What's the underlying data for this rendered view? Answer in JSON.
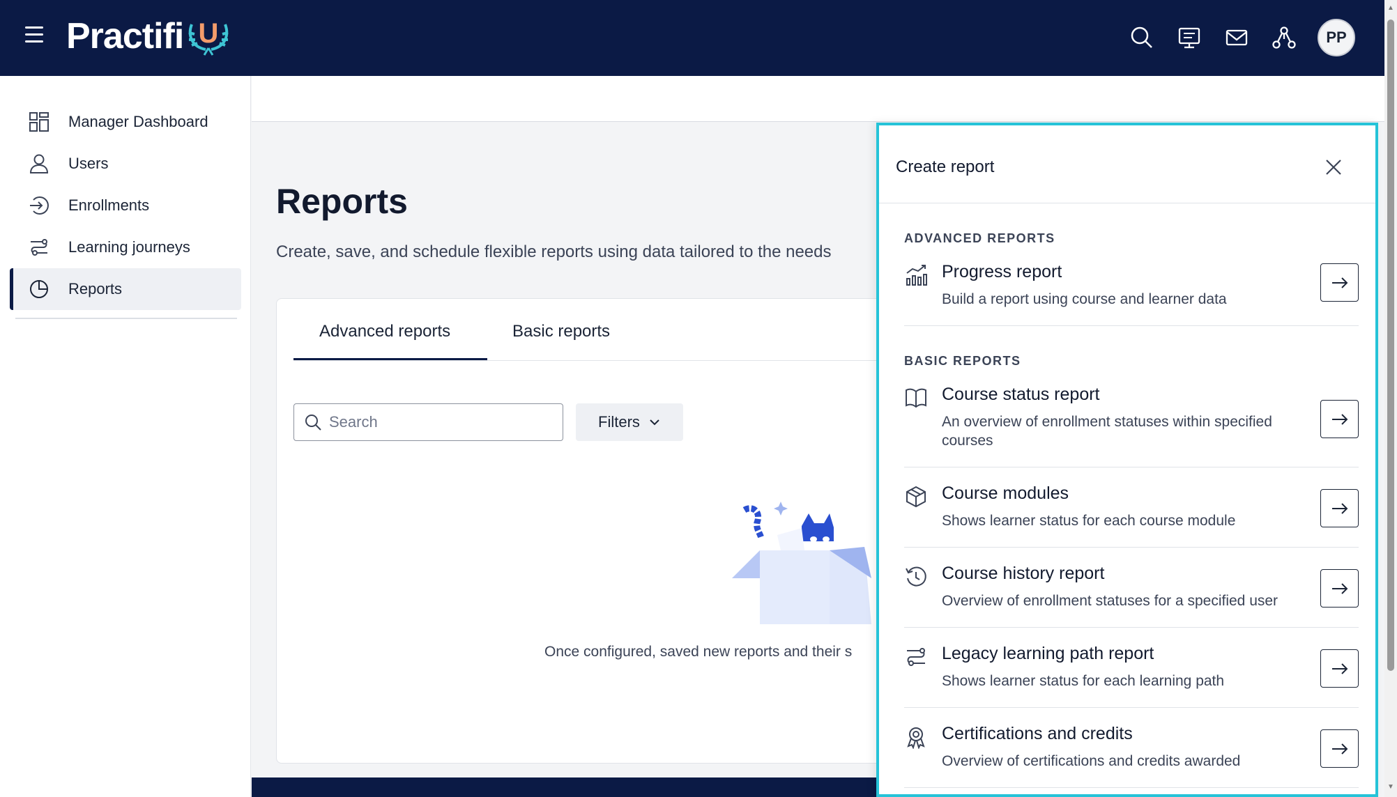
{
  "header": {
    "logo_text": "Practifi",
    "logo_letter": "U",
    "avatar_initials": "PP",
    "colors": {
      "navy": "#0b1a45",
      "accent_orange": "#f39c6b",
      "accent_teal": "#3ec4d4"
    }
  },
  "sidebar": {
    "items": [
      {
        "label": "Manager Dashboard",
        "icon": "dashboard-icon"
      },
      {
        "label": "Users",
        "icon": "user-icon"
      },
      {
        "label": "Enrollments",
        "icon": "enroll-icon"
      },
      {
        "label": "Learning journeys",
        "icon": "journey-icon"
      },
      {
        "label": "Reports",
        "icon": "pie-chart-icon",
        "active": true
      }
    ]
  },
  "main": {
    "title": "Reports",
    "description": "Create, save, and schedule flexible reports using data tailored to the needs",
    "tabs": [
      {
        "label": "Advanced reports",
        "active": true
      },
      {
        "label": "Basic reports",
        "active": false
      }
    ],
    "search": {
      "placeholder": "Search",
      "value": ""
    },
    "filters_label": "Filters",
    "empty_text": "Once configured, saved new reports and their s"
  },
  "drawer": {
    "title": "Create report",
    "accent_border": "#26c3d8",
    "sections": [
      {
        "label": "ADVANCED REPORTS",
        "items": [
          {
            "title": "Progress report",
            "desc": "Build a report using course and learner data",
            "icon": "bar-chart-icon"
          }
        ]
      },
      {
        "label": "BASIC REPORTS",
        "items": [
          {
            "title": "Course status report",
            "desc": "An overview of enrollment statuses within specified courses",
            "icon": "book-icon"
          },
          {
            "title": "Course modules",
            "desc": "Shows learner status for each course module",
            "icon": "cube-icon"
          },
          {
            "title": "Course history report",
            "desc": "Overview of enrollment statuses for a specified user",
            "icon": "history-icon"
          },
          {
            "title": "Legacy learning path report",
            "desc": "Shows learner status for each learning path",
            "icon": "path-icon"
          },
          {
            "title": "Certifications and credits",
            "desc": "Overview of certifications and credits awarded",
            "icon": "award-icon"
          }
        ]
      }
    ]
  }
}
